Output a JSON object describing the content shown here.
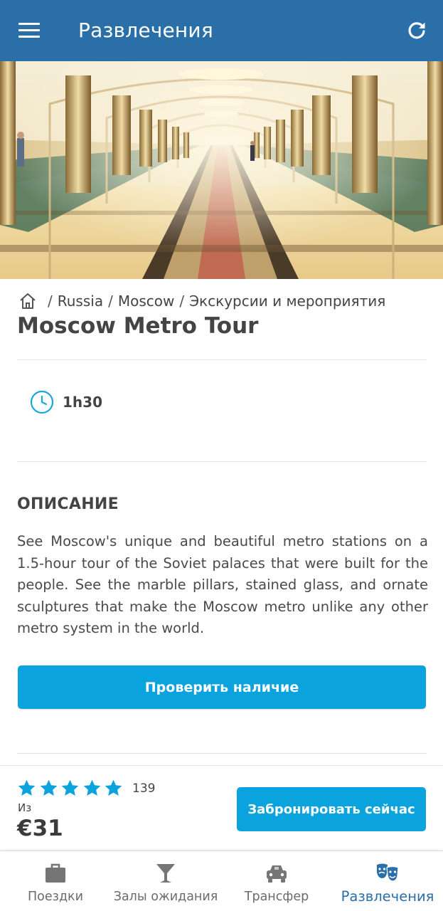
{
  "appbar": {
    "title": "Развлечения",
    "accent": "#2a6fa8"
  },
  "hero": {
    "alt_subject": "metro-station-hall"
  },
  "breadcrumb": {
    "items": [
      "Russia",
      "Moscow",
      "Экскурсии и мероприятия"
    ],
    "separator": "/"
  },
  "tour": {
    "title": "Moscow Metro Tour",
    "duration": "1h30",
    "section_heading": "ОПИСАНИЕ",
    "description": "See Moscow's unique and beautiful metro stations on a 1.5-hour tour of the Soviet palaces that were built for the people. See the marble pillars, stained glass, and ornate sculptures that make the Moscow metro unlike any other metro system in the world.",
    "check_button": "Проверить наличие"
  },
  "booking": {
    "rating_stars": 5,
    "rating_count": "139",
    "from_label": "Из",
    "price": "€31",
    "book_button": "Забронировать сейчас",
    "button_color": "#0aa3dd",
    "star_color": "#0aa3dd"
  },
  "bottom_nav": {
    "items": [
      {
        "label": "Поездки",
        "icon": "suitcase-icon"
      },
      {
        "label": "Залы ожидания",
        "icon": "cocktail-glass-icon"
      },
      {
        "label": "Трансфер",
        "icon": "taxi-icon"
      },
      {
        "label": "Развлечения",
        "icon": "theater-masks-icon",
        "active": true
      }
    ]
  }
}
